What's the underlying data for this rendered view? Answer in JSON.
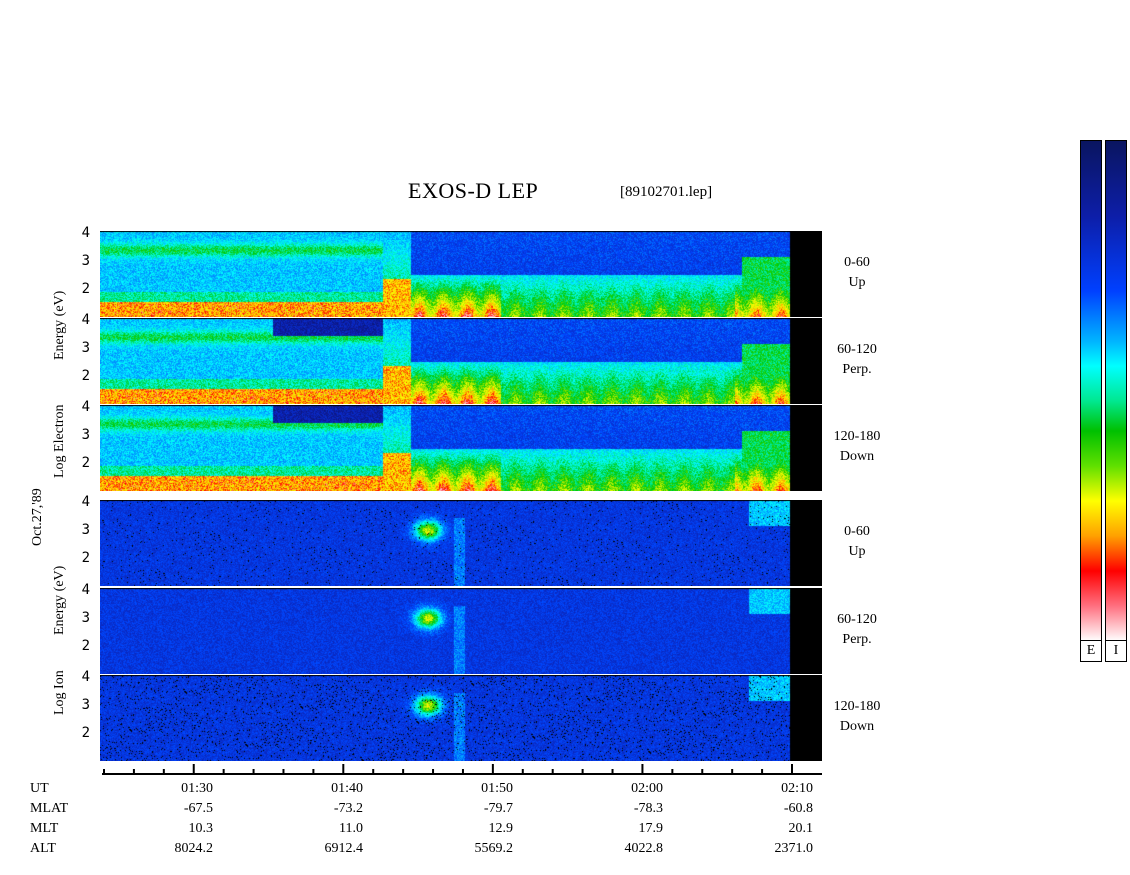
{
  "header": {
    "title": "EXOS-D LEP",
    "file": "[89102701.lep]"
  },
  "date_label": "Oct.27,'89",
  "electron_axis_label": "Electron Energy (eV)",
  "ion_axis_label": "Ion Energy (eV)",
  "log_label": "Log",
  "electron_ylabel_top": "Energy (eV)",
  "electron_ylabel_bottom": "Log  Electron",
  "ion_ylabel_top": "Energy (eV)",
  "ion_ylabel_bottom": "Log  Ion",
  "y_ticks": [
    "4",
    "3",
    "2"
  ],
  "panels": [
    {
      "group": "electron",
      "angle": "0-60",
      "dir": "Up"
    },
    {
      "group": "electron",
      "angle": "60-120",
      "dir": "Perp."
    },
    {
      "group": "electron",
      "angle": "120-180",
      "dir": "Down"
    },
    {
      "group": "ion",
      "angle": "0-60",
      "dir": "Up"
    },
    {
      "group": "ion",
      "angle": "60-120",
      "dir": "Perp."
    },
    {
      "group": "ion",
      "angle": "120-180",
      "dir": "Down"
    }
  ],
  "colorbars": [
    {
      "label": "E"
    },
    {
      "label": "I"
    }
  ],
  "time_axis": {
    "row_labels": [
      "UT",
      "MLAT",
      "MLT",
      "ALT"
    ],
    "ticks": [
      {
        "UT": "01:30",
        "MLAT": "-67.5",
        "MLT": "10.3",
        "ALT": "8024.2"
      },
      {
        "UT": "01:40",
        "MLAT": "-73.2",
        "MLT": "11.0",
        "ALT": "6912.4"
      },
      {
        "UT": "01:50",
        "MLAT": "-79.7",
        "MLT": "12.9",
        "ALT": "5569.2"
      },
      {
        "UT": "02:00",
        "MLAT": "-78.3",
        "MLT": "17.9",
        "ALT": "4022.8"
      },
      {
        "UT": "02:10",
        "MLAT": "-60.8",
        "MLT": "20.1",
        "ALT": "2371.0"
      }
    ]
  },
  "chart_data": {
    "type": "heatmap",
    "title": "EXOS-D LEP",
    "xlabel": "UT",
    "ylabel": "Log Energy (eV)",
    "x_range_minutes_ut": [
      "01:24",
      "02:10"
    ],
    "ylim": [
      1,
      4.2
    ],
    "colorscale": [
      "#0a1560",
      "#0040ff",
      "#00ffff",
      "#00c000",
      "#ffff00",
      "#ff0000",
      "#ffffff"
    ],
    "panels": [
      "electron 0-60 Up",
      "electron 60-120 Perp.",
      "electron 120-180 Down",
      "ion 0-60 Up",
      "ion 60-120 Perp.",
      "ion 120-180 Down"
    ]
  }
}
